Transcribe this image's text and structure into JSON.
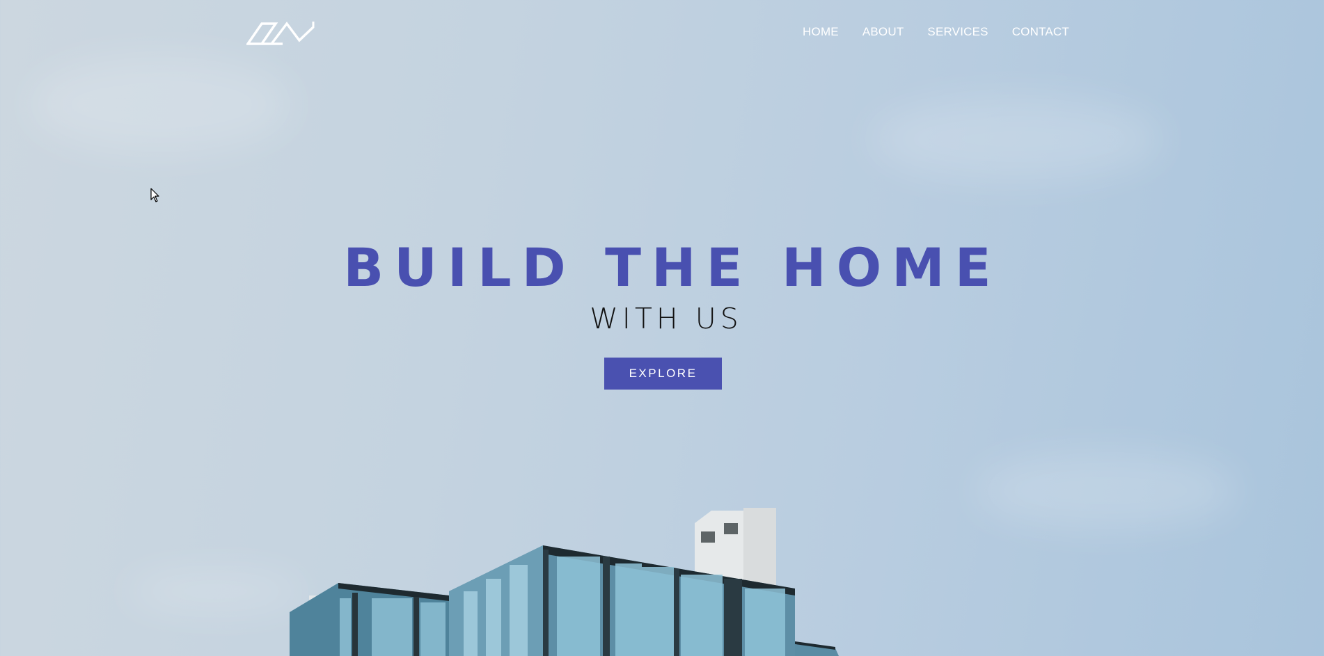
{
  "nav": {
    "logo_name": "house-roof-logo",
    "links": [
      {
        "label": "HOME"
      },
      {
        "label": "ABOUT"
      },
      {
        "label": "SERVICES"
      },
      {
        "label": "CONTACT"
      }
    ]
  },
  "hero": {
    "title": "BUILD THE HOME",
    "subtitle": "WITH US",
    "cta_label": "EXPLORE"
  },
  "colors": {
    "accent": "#4a51b0",
    "sky_light": "#ccd7e0",
    "sky_dark": "#a9c4dc",
    "subtitle_text": "#111111",
    "nav_text": "#ffffff"
  },
  "background_image": "glass-building-against-sky"
}
